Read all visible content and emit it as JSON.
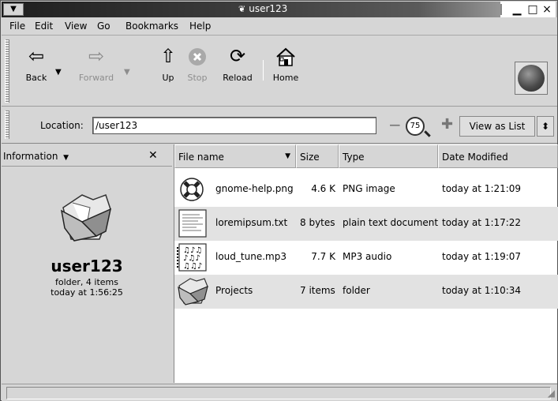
{
  "window": {
    "title": "user123",
    "title_icon": "paw-icon",
    "buttons": {
      "minimize": "▁",
      "maximize": "□",
      "close": "×"
    }
  },
  "menubar": {
    "items": [
      {
        "label": "File"
      },
      {
        "label": "Edit"
      },
      {
        "label": "View"
      },
      {
        "label": "Go"
      },
      {
        "label": "Bookmarks"
      },
      {
        "label": "Help"
      }
    ]
  },
  "toolbar": {
    "back": "Back",
    "forward": "Forward",
    "up": "Up",
    "stop": "Stop",
    "reload": "Reload",
    "home": "Home"
  },
  "location": {
    "label": "Location:",
    "value": "/user123",
    "zoom_level": "75",
    "view_as_label": "View as List"
  },
  "sidebar": {
    "title": "Information",
    "folder_name": "user123",
    "info_line1": "folder, 4 items",
    "info_line2": "today at 1:56:25"
  },
  "file_list": {
    "columns": [
      {
        "label": "File name"
      },
      {
        "label": "Size"
      },
      {
        "label": "Type"
      },
      {
        "label": "Date Modified"
      }
    ],
    "rows": [
      {
        "name": "gnome-help.png",
        "size": "4.6 K",
        "type": "PNG image",
        "date": "today at 1:21:09",
        "icon": "lifebuoy-icon"
      },
      {
        "name": "loremipsum.txt",
        "size": "8 bytes",
        "type": "plain text document",
        "date": "today at 1:17:22",
        "icon": "text-document-icon"
      },
      {
        "name": "loud_tune.mp3",
        "size": "7.7 K",
        "type": "MP3 audio",
        "date": "today at 1:19:07",
        "icon": "music-score-icon"
      },
      {
        "name": "Projects",
        "size": "7 items",
        "type": "folder",
        "date": "today at 1:10:34",
        "icon": "folder-icon"
      }
    ]
  },
  "colors": {
    "window_bg": "#d6d6d6",
    "row_shade": "#e2e2e2"
  }
}
